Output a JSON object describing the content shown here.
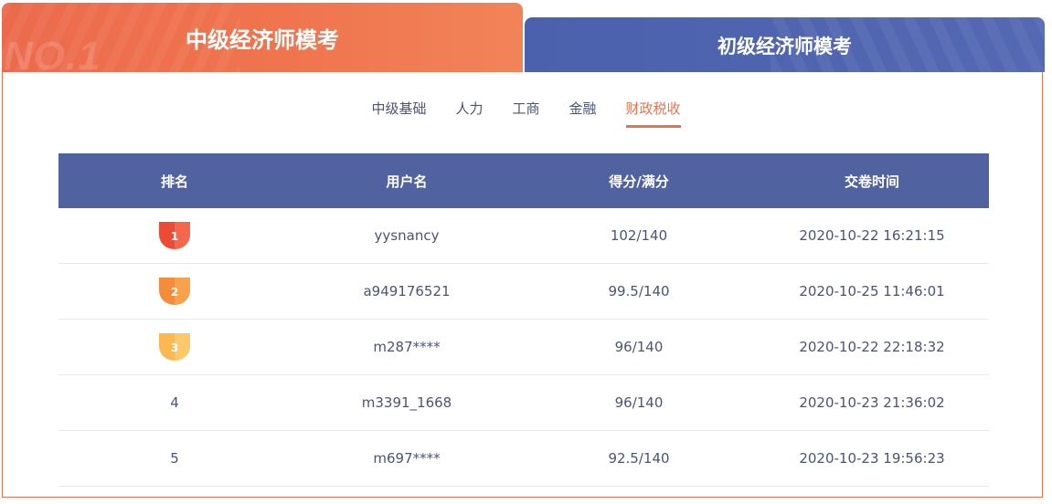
{
  "tabs": {
    "active": {
      "label": "中级经济师模考",
      "watermark": "NO.1"
    },
    "inactive": {
      "label": "初级经济师模考"
    }
  },
  "subtabs": [
    "中级基础",
    "人力",
    "工商",
    "金融",
    "财政税收"
  ],
  "active_subtab": "财政税收",
  "table": {
    "headers": [
      "排名",
      "用户名",
      "得分/满分",
      "交卷时间"
    ],
    "rows": [
      {
        "rank": "1",
        "user": "yysnancy",
        "score": "102/140",
        "time": "2020-10-22 16:21:15",
        "medal": "gold-red"
      },
      {
        "rank": "2",
        "user": "a949176521",
        "score": "99.5/140",
        "time": "2020-10-25 11:46:01",
        "medal": "orange"
      },
      {
        "rank": "3",
        "user": "m287****",
        "score": "96/140",
        "time": "2020-10-22 22:18:32",
        "medal": "yellow"
      },
      {
        "rank": "4",
        "user": "m3391_1668",
        "score": "96/140",
        "time": "2020-10-23 21:36:02",
        "medal": ""
      },
      {
        "rank": "5",
        "user": "m697****",
        "score": "92.5/140",
        "time": "2020-10-23 19:56:23",
        "medal": ""
      }
    ]
  },
  "colors": {
    "accent": "#e8734f",
    "header_bg": "#5162a0",
    "inactive_tab": "#4b61ad",
    "text": "#4a5478",
    "medal_1": "#ee4b36",
    "medal_2": "#f58c3b",
    "medal_3": "#fbb851"
  }
}
